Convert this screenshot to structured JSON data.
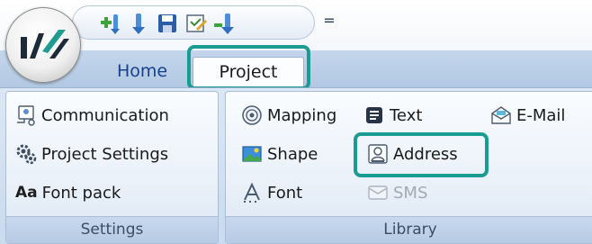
{
  "colors": {
    "highlight": "#1a9c92",
    "tab_text": "#15428b",
    "ribbon_bg": "#dbe7f5"
  },
  "quick_access": {
    "buttons": [
      {
        "name": "add-item-icon"
      },
      {
        "name": "insert-icon"
      },
      {
        "name": "save-icon"
      },
      {
        "name": "edit-report-icon"
      },
      {
        "name": "import-icon"
      }
    ],
    "dropdown_glyph": "="
  },
  "tabs": {
    "home": "Home",
    "project": "Project"
  },
  "groups": {
    "settings": {
      "label": "Settings",
      "items": {
        "communication": "Communication",
        "project_settings": "Project Settings",
        "font_pack_prefix": "Aa",
        "font_pack": "Font pack"
      }
    },
    "library": {
      "label": "Library",
      "items": {
        "mapping": "Mapping",
        "text": "Text",
        "email": "E-Mail",
        "shape": "Shape",
        "address": "Address",
        "font": "Font",
        "sms": "SMS"
      }
    }
  }
}
